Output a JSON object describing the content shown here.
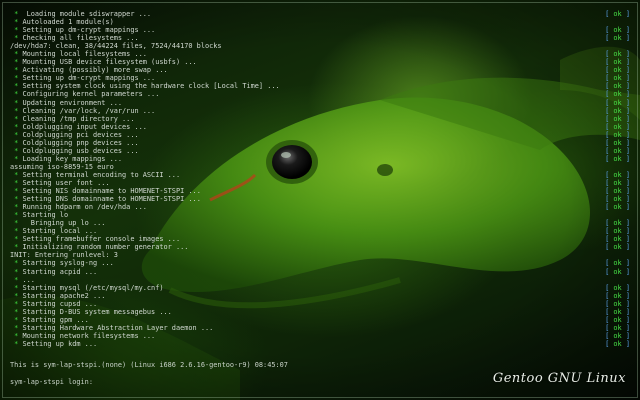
{
  "boot_lines": [
    {
      "bullet": true,
      "text": " Loading module sdiswrapper ...",
      "status": "ok"
    },
    {
      "bullet": true,
      "text": "Autoloaded 1 module(s)",
      "status": ""
    },
    {
      "bullet": true,
      "text": "Setting up dm-crypt mappings ...",
      "status": "ok"
    },
    {
      "bullet": true,
      "text": "Checking all filesystems ...",
      "status": "ok"
    },
    {
      "bullet": false,
      "text": "/dev/hda7: clean, 38/44224 files, 7524/44170 blocks",
      "status": ""
    },
    {
      "bullet": true,
      "text": "Mounting local filesystems ...",
      "status": "ok"
    },
    {
      "bullet": true,
      "text": "Mounting USB device filesystem (usbfs) ...",
      "status": "ok"
    },
    {
      "bullet": true,
      "text": "Activating (possibly) more swap ...",
      "status": "ok"
    },
    {
      "bullet": true,
      "text": "Setting up dm-crypt mappings ...",
      "status": "ok"
    },
    {
      "bullet": true,
      "text": "Setting system clock using the hardware clock [Local Time] ...",
      "status": "ok"
    },
    {
      "bullet": true,
      "text": "Configuring kernel parameters ...",
      "status": "ok"
    },
    {
      "bullet": true,
      "text": "Updating environment ...",
      "status": "ok"
    },
    {
      "bullet": true,
      "text": "Cleaning /var/lock, /var/run ...",
      "status": "ok"
    },
    {
      "bullet": true,
      "text": "Cleaning /tmp directory ...",
      "status": "ok"
    },
    {
      "bullet": true,
      "text": "Coldplugging input devices ...",
      "status": "ok"
    },
    {
      "bullet": true,
      "text": "Coldplugging pci devices ...",
      "status": "ok"
    },
    {
      "bullet": true,
      "text": "Coldplugging pnp devices ...",
      "status": "ok"
    },
    {
      "bullet": true,
      "text": "Coldplugging usb devices ...",
      "status": "ok"
    },
    {
      "bullet": true,
      "text": "Loading key mappings ...",
      "status": "ok"
    },
    {
      "bullet": false,
      "text": "assuming iso-8859-15 euro",
      "status": ""
    },
    {
      "bullet": true,
      "text": "Setting terminal encoding to ASCII ...",
      "status": "ok"
    },
    {
      "bullet": true,
      "text": "Setting user font ...",
      "status": "ok"
    },
    {
      "bullet": true,
      "text": "Setting NIS domainname to HOMENET-STSPI ...",
      "status": "ok"
    },
    {
      "bullet": true,
      "text": "Setting DNS domainname to HOMENET-STSPI ...",
      "status": "ok"
    },
    {
      "bullet": true,
      "text": "Running hdparm on /dev/hda ...",
      "status": "ok"
    },
    {
      "bullet": true,
      "text": "Starting lo",
      "status": ""
    },
    {
      "bullet": true,
      "text": "  Bringing up lo ...",
      "status": "ok"
    },
    {
      "bullet": true,
      "text": "Starting local ...",
      "status": "ok"
    },
    {
      "bullet": true,
      "text": "Setting framebuffer console images ...",
      "status": "ok"
    },
    {
      "bullet": true,
      "text": "Initializing random number generator ...",
      "status": "ok"
    },
    {
      "bullet": false,
      "text": "INIT: Entering runlevel: 3",
      "status": ""
    },
    {
      "bullet": true,
      "text": "Starting syslog-ng ...",
      "status": "ok"
    },
    {
      "bullet": true,
      "text": "Starting acpid ...",
      "status": "ok"
    },
    {
      "bullet": true,
      "text": "...",
      "status": ""
    },
    {
      "bullet": true,
      "text": "Starting mysql (/etc/mysql/my.cnf)",
      "status": "ok"
    },
    {
      "bullet": true,
      "text": "Starting apache2 ...",
      "status": "ok"
    },
    {
      "bullet": true,
      "text": "Starting cupsd ...",
      "status": "ok"
    },
    {
      "bullet": true,
      "text": "Starting D-BUS system messagebus ...",
      "status": "ok"
    },
    {
      "bullet": true,
      "text": "Starting gpm ...",
      "status": "ok"
    },
    {
      "bullet": true,
      "text": "Starting Hardware Abstraction Layer daemon ...",
      "status": "ok"
    },
    {
      "bullet": true,
      "text": "Mounting network filesystems ...",
      "status": "ok"
    },
    {
      "bullet": true,
      "text": "Setting up kdm ...",
      "status": "ok"
    }
  ],
  "bullet_char": "*",
  "status_ok_label": "ok",
  "kernel_banner": "This is sym-lap-stspi.(none) (Linux i686 2.6.16-gentoo-r9) 08:45:07",
  "login_prompt": "sym-lap-stspi login:",
  "brand_text": "Gentoo GNU Linux",
  "colors": {
    "bullet": "#3fdc3f",
    "ok_text": "#46dc46",
    "brackets": "#5aa0e8",
    "console_text": "#d0d8d0",
    "background": "#143109"
  }
}
